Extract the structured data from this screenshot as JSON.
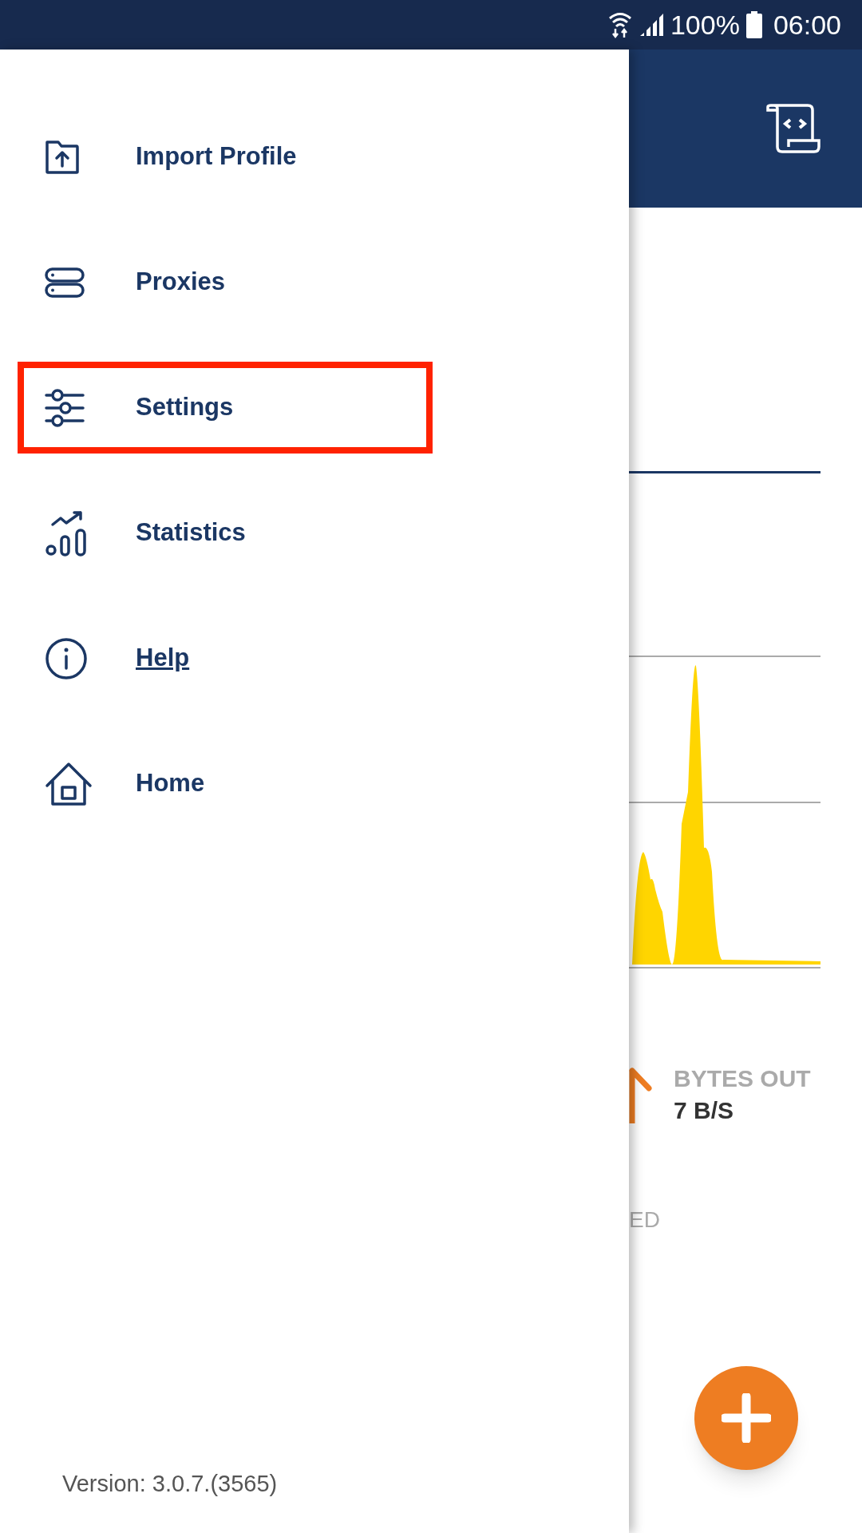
{
  "status_bar": {
    "battery": "100%",
    "time": "06:00"
  },
  "drawer": {
    "items": [
      {
        "label": "Import Profile",
        "highlighted": false,
        "underlined": false
      },
      {
        "label": "Proxies",
        "highlighted": false,
        "underlined": false
      },
      {
        "label": "Settings",
        "highlighted": true,
        "underlined": false
      },
      {
        "label": "Statistics",
        "highlighted": false,
        "underlined": false
      },
      {
        "label": "Help",
        "highlighted": false,
        "underlined": true
      },
      {
        "label": "Home",
        "highlighted": false,
        "underlined": false
      }
    ],
    "version": "Version: 3.0.7.(3565)"
  },
  "main": {
    "stats": [
      {
        "label": "BYTES OUT",
        "value": "7 B/S"
      }
    ],
    "partial_text": "ED"
  }
}
